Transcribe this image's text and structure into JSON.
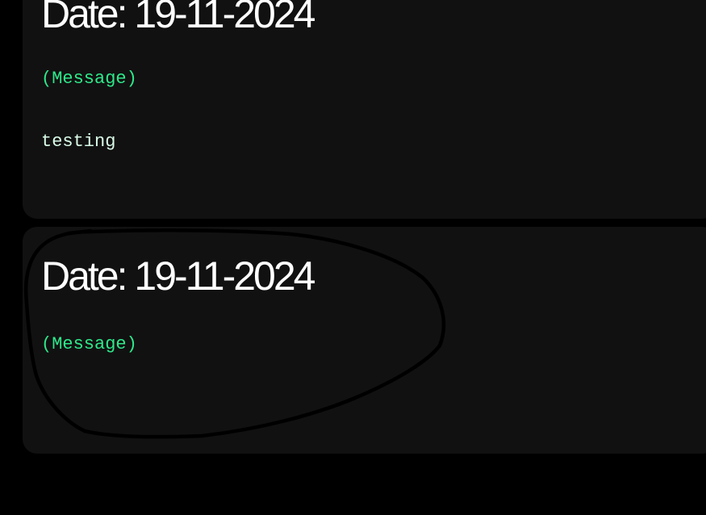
{
  "entries": [
    {
      "date": "Date: 19-11-2024",
      "label": "(Message)",
      "message": "testing"
    },
    {
      "date": "Date: 19-11-2024",
      "label": "(Message)",
      "message": ""
    }
  ],
  "colors": {
    "background": "#000000",
    "card": "#111111",
    "date_text": "#ffffff",
    "label_text": "#2ee88a",
    "message_text": "#d9fbe8",
    "annotation_stroke": "#000000"
  },
  "annotation": {
    "icon": "hand-drawn-circle-icon"
  }
}
